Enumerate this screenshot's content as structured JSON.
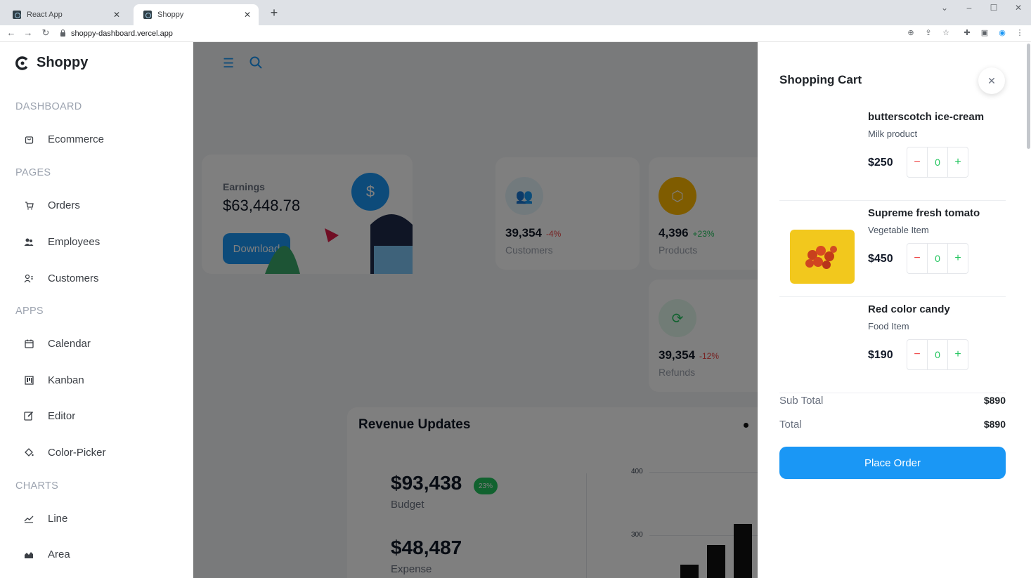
{
  "browser": {
    "tabs": [
      {
        "title": "React App",
        "close": "✕"
      },
      {
        "title": "Shoppy",
        "close": "✕"
      }
    ],
    "new_tab": "+",
    "url": "shoppy-dashboard.vercel.app"
  },
  "sidebar": {
    "brand": "Shoppy",
    "sections": [
      {
        "title": "DASHBOARD",
        "items": [
          {
            "label": "Ecommerce",
            "icon": "bag-icon"
          }
        ]
      },
      {
        "title": "PAGES",
        "items": [
          {
            "label": "Orders",
            "icon": "cart-icon"
          },
          {
            "label": "Employees",
            "icon": "people-icon"
          },
          {
            "label": "Customers",
            "icon": "customers-icon"
          }
        ]
      },
      {
        "title": "APPS",
        "items": [
          {
            "label": "Calendar",
            "icon": "calendar-icon"
          },
          {
            "label": "Kanban",
            "icon": "kanban-icon"
          },
          {
            "label": "Editor",
            "icon": "edit-icon"
          },
          {
            "label": "Color-Picker",
            "icon": "paint-bucket-icon"
          }
        ]
      },
      {
        "title": "CHARTS",
        "items": [
          {
            "label": "Line",
            "icon": "line-chart-icon"
          },
          {
            "label": "Area",
            "icon": "area-chart-icon"
          }
        ]
      }
    ]
  },
  "dashboard": {
    "earnings": {
      "label": "Earnings",
      "value": "$63,448.78",
      "button": "Download",
      "badge": "$"
    },
    "stats": [
      {
        "value": "39,354",
        "change": "-4%",
        "label": "Customers",
        "change_color": "#ef4444",
        "icon_bg": "#e5f4fb",
        "icon_color": "#03c9d7"
      },
      {
        "value": "4,396",
        "change": "+23%",
        "label": "Products",
        "change_color": "#22c55e",
        "icon_bg": "#fff7d6",
        "icon_color": "#ffb800"
      },
      {
        "value": "39,354",
        "change": "-12%",
        "label": "Refunds",
        "change_color": "#ef4444",
        "icon_bg": "#e3f8ec",
        "icon_color": "#22c55e"
      }
    ],
    "revenue": {
      "title": "Revenue Updates",
      "budget": "$93,438",
      "budget_badge": "23%",
      "budget_label": "Budget",
      "expense": "$48,487",
      "expense_label": "Expense",
      "axis": [
        "400",
        "300"
      ]
    }
  },
  "cart": {
    "title": "Shopping Cart",
    "items": [
      {
        "name": "butterscotch ice-cream",
        "category": "Milk product",
        "price": "$250",
        "qty": "0",
        "has_image": false
      },
      {
        "name": "Supreme fresh tomato",
        "category": "Vegetable Item",
        "price": "$450",
        "qty": "0",
        "has_image": true
      },
      {
        "name": "Red color candy",
        "category": "Food Item",
        "price": "$190",
        "qty": "0",
        "has_image": false
      }
    ],
    "minus": "−",
    "plus": "+",
    "subtotal_label": "Sub Total",
    "subtotal": "$890",
    "total_label": "Total",
    "total": "$890",
    "place_order": "Place Order"
  },
  "colors": {
    "accent": "#1a97f5",
    "overlay": "rgba(0,0,0,0.5)"
  }
}
